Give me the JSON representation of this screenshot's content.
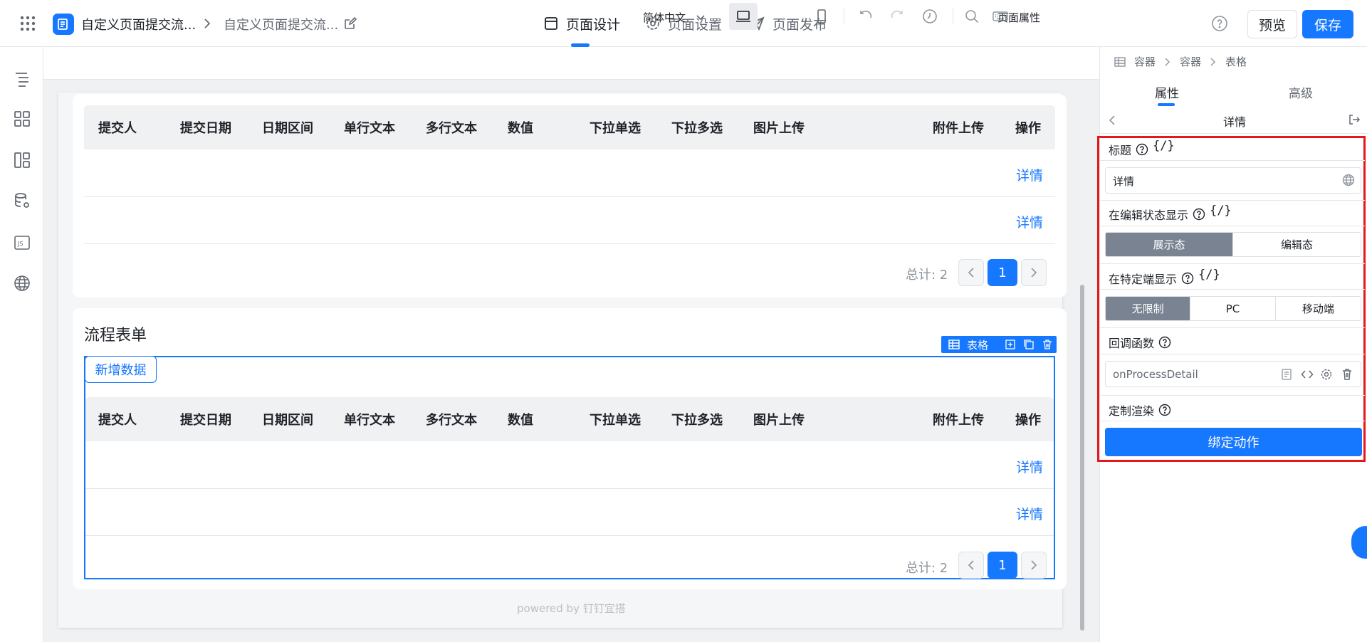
{
  "header": {
    "crumb_app": "自定义页面提交流...",
    "crumb_page": "自定义页面提交流...",
    "tabs": [
      {
        "label": "页面设计"
      },
      {
        "label": "页面设置"
      },
      {
        "label": "页面发布"
      }
    ],
    "preview_label": "预览",
    "save_label": "保存"
  },
  "toolbar": {
    "language": "简体中文",
    "page_props_label": "页面属性"
  },
  "table": {
    "columns": [
      "提交人",
      "提交日期",
      "日期区间",
      "单行文本",
      "多行文本",
      "数值",
      "下拉单选",
      "下拉多选",
      "图片上传",
      "附件上传",
      "操作"
    ],
    "row_action": "详情",
    "total_label": "总计: 2",
    "current_page": "1"
  },
  "section2": {
    "title": "流程表单",
    "component_tag": "表格",
    "add_data_label": "新增数据"
  },
  "footer": {
    "powered": "powered by 钉钉宜搭"
  },
  "right_panel": {
    "breadcrumb": [
      "容器",
      "容器",
      "表格"
    ],
    "tabs": [
      "属性",
      "高级"
    ],
    "sub_title": "详情",
    "title_label": "标题",
    "expr_symbol": "{/}",
    "title_value": "详情",
    "edit_state_label": "在编辑状态显示",
    "edit_state_options": [
      "展示态",
      "编辑态"
    ],
    "terminal_label": "在特定端显示",
    "terminal_options": [
      "无限制",
      "PC",
      "移动端"
    ],
    "callback_label": "回调函数",
    "callback_value": "onProcessDetail",
    "custom_render_label": "定制渲染",
    "bind_action_label": "绑定动作"
  },
  "colors": {
    "accent": "#1677ff",
    "highlight": "#e5171d",
    "segment_active": "#7a8391"
  }
}
